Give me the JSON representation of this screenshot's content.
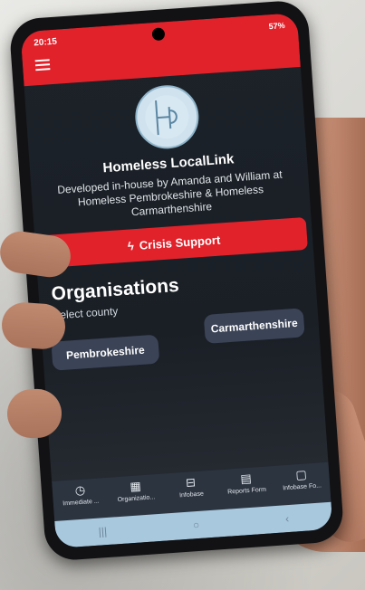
{
  "status_bar": {
    "time": "20:15",
    "right_text": "57%"
  },
  "app": {
    "title": "Homeless LocalLink",
    "subtitle": "Developed in-house by Amanda and William at Homeless Pembrokeshire & Homeless Carmarthenshire"
  },
  "crisis": {
    "label": "Crisis Support",
    "icon": "lightning-icon"
  },
  "organisations": {
    "title": "Organisations",
    "select_label": "Select county",
    "counties": [
      "Pembrokeshire",
      "Carmarthenshire"
    ]
  },
  "tabs": [
    {
      "label": "Immediate ...",
      "icon": "clock-icon"
    },
    {
      "label": "Organizatio...",
      "icon": "building-icon"
    },
    {
      "label": "Infobase",
      "icon": "book-icon"
    },
    {
      "label": "Reports Form",
      "icon": "report-icon"
    },
    {
      "label": "Infobase Fo...",
      "icon": "chat-icon"
    }
  ],
  "system_nav": {
    "recents": "|||",
    "home": "○",
    "back": "‹"
  },
  "colors": {
    "brand_red": "#e1222b",
    "screen_bg": "#1c2229",
    "county_button": "#3b4356"
  }
}
